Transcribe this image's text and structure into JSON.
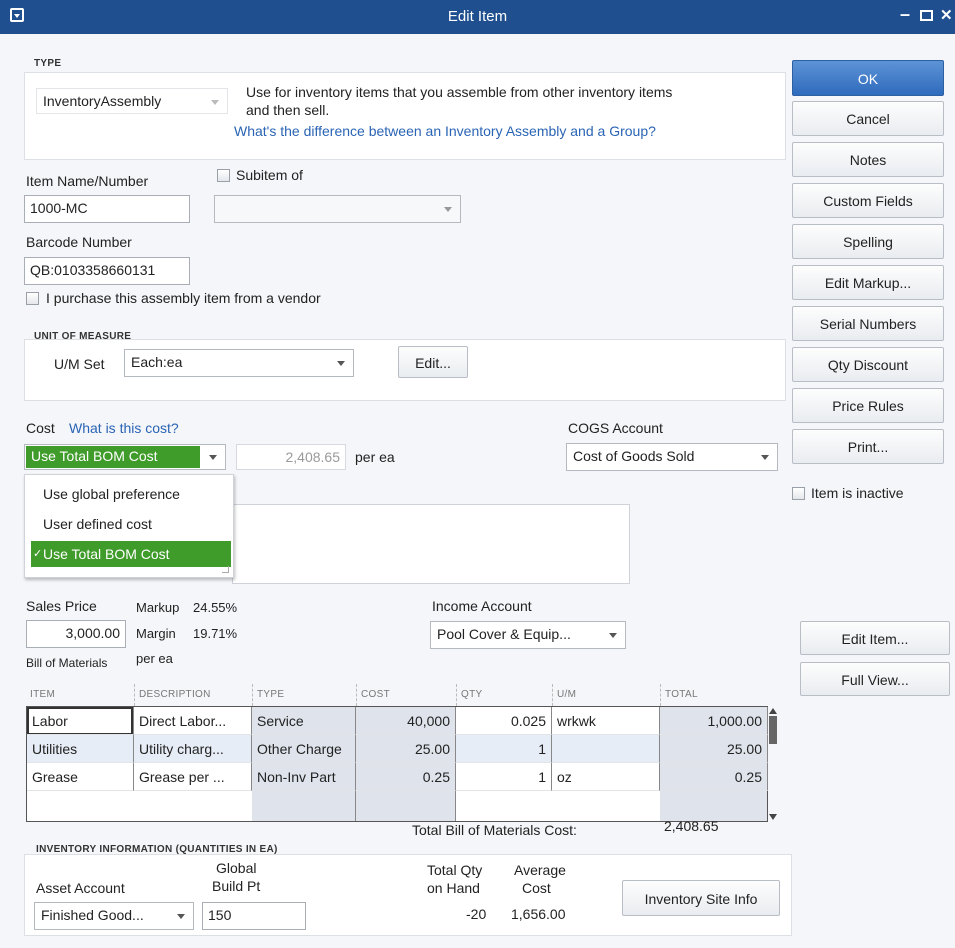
{
  "window": {
    "title": "Edit Item"
  },
  "type_section": {
    "caption": "TYPE",
    "type_value": "InventoryAssembly",
    "description_line1": "Use for inventory items that you assemble from other inventory items",
    "description_line2": "and then sell.",
    "help_link": "What's the difference between an Inventory Assembly and a Group?"
  },
  "item": {
    "name_label": "Item Name/Number",
    "name_value": "1000-MC",
    "subitem_label": "Subitem of",
    "subitem_value": "",
    "barcode_label": "Barcode Number",
    "barcode_value": "QB:0103358660131",
    "purchase_label": "I purchase this assembly item from a vendor"
  },
  "uom": {
    "caption": "UNIT OF MEASURE",
    "set_label": "U/M Set",
    "set_value": "Each:ea",
    "edit_button": "Edit..."
  },
  "cost": {
    "label": "Cost",
    "help_link": "What is this cost?",
    "selected": "Use Total BOM Cost",
    "value": "2,408.65",
    "per": "per ea",
    "options": [
      "Use global preference",
      "User defined cost",
      "Use Total BOM Cost"
    ],
    "selected_index": 2,
    "checkmark": "✓"
  },
  "cogs": {
    "label": "COGS Account",
    "value": "Cost of Goods Sold"
  },
  "sales": {
    "price_label": "Sales Price",
    "price_value": "3,000.00",
    "markup_label": "Markup",
    "markup_value": "24.55%",
    "margin_label": "Margin",
    "margin_value": "19.71%",
    "per": "per ea",
    "income_label": "Income Account",
    "income_value": "Pool Cover & Equip..."
  },
  "bom": {
    "caption": "Bill of Materials",
    "columns": [
      "ITEM",
      "DESCRIPTION",
      "TYPE",
      "COST",
      "QTY",
      "U/M",
      "TOTAL"
    ],
    "rows": [
      {
        "item": "Labor",
        "description": "Direct Labor...",
        "type": "Service",
        "cost": "40,000",
        "qty": "0.025",
        "um": "wrkwk",
        "total": "1,000.00"
      },
      {
        "item": "Utilities",
        "description": "Utility charg...",
        "type": "Other Charge",
        "cost": "25.00",
        "qty": "1",
        "um": "",
        "total": "25.00"
      },
      {
        "item": "Grease",
        "description": "Grease per ...",
        "type": "Non-Inv Part",
        "cost": "0.25",
        "qty": "1",
        "um": "oz",
        "total": "0.25"
      }
    ],
    "total_label": "Total Bill of Materials Cost:",
    "total_value": "2,408.65"
  },
  "inventory": {
    "caption": "INVENTORY INFORMATION (QUANTITIES IN EA)",
    "asset_label": "Asset Account",
    "asset_value": "Finished Good...",
    "build_label_1": "Global",
    "build_label_2": "Build Pt",
    "build_value": "150",
    "onhand_label_1": "Total Qty",
    "onhand_label_2": "on Hand",
    "onhand_value": "-20",
    "avg_label_1": "Average",
    "avg_label_2": "Cost",
    "avg_value": "1,656.00",
    "site_button": "Inventory Site Info"
  },
  "side": {
    "ok": "OK",
    "cancel": "Cancel",
    "notes": "Notes",
    "custom_fields": "Custom Fields",
    "spelling": "Spelling",
    "edit_markup": "Edit Markup...",
    "serial_numbers": "Serial Numbers",
    "qty_discount": "Qty Discount",
    "price_rules": "Price Rules",
    "print": "Print...",
    "inactive_label": "Item is inactive",
    "edit_item": "Edit Item...",
    "full_view": "Full View..."
  },
  "colors": {
    "title_bar": "#1f4f8f",
    "ok_button": "#3a76c4",
    "selected_option": "#3f9b2a",
    "link": "#2a64b4"
  }
}
